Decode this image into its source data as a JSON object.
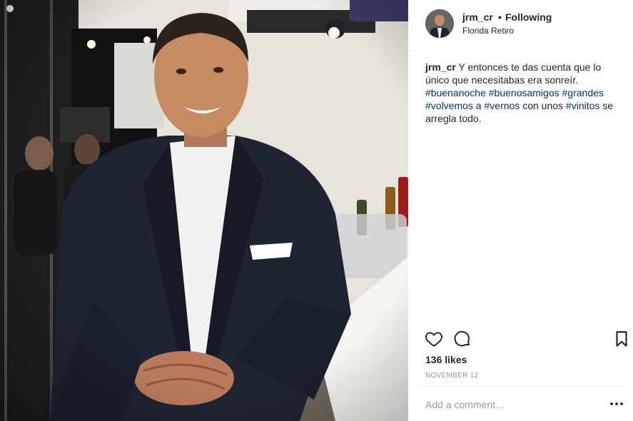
{
  "post": {
    "username": "jrm_cr",
    "dot": "•",
    "follow_status": "Following",
    "location": "Florida Retiro"
  },
  "caption": {
    "username": "jrm_cr",
    "segments": [
      {
        "text": " Y entonces te das cuenta que lo único que necesitabas era sonreír. ",
        "tag": false
      },
      {
        "text": "#buenanoche",
        "tag": true
      },
      {
        "text": " ",
        "tag": false
      },
      {
        "text": "#buenosamigos",
        "tag": true
      },
      {
        "text": " ",
        "tag": false
      },
      {
        "text": "#grandes",
        "tag": true
      },
      {
        "text": " ",
        "tag": false
      },
      {
        "text": "#volvemos",
        "tag": true
      },
      {
        "text": " a ",
        "tag": false
      },
      {
        "text": "#vernos",
        "tag": true
      },
      {
        "text": " con unos ",
        "tag": false
      },
      {
        "text": "#vinitos",
        "tag": true
      },
      {
        "text": " se arregla todo.",
        "tag": false
      }
    ]
  },
  "engagement": {
    "likes": "136 likes",
    "date": "NOVEMBER 12"
  },
  "comment": {
    "placeholder": "Add a comment…",
    "more_label": "•••"
  },
  "icons": {
    "like": "heart-outline-icon",
    "comment": "speech-bubble-icon",
    "save": "bookmark-icon",
    "more": "ellipsis-icon"
  },
  "colors": {
    "hashtag": "#003569",
    "text": "#262626",
    "muted": "#999999",
    "divider": "#efefef"
  }
}
